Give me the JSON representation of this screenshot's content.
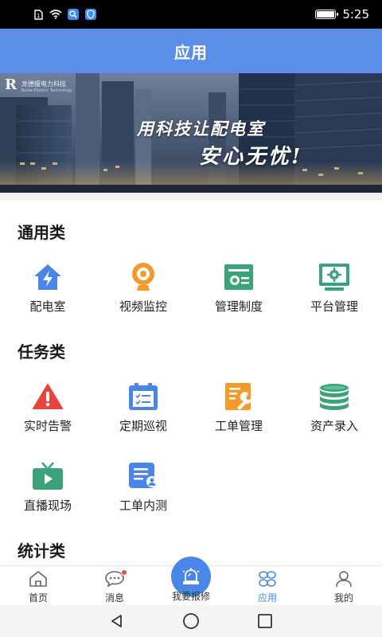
{
  "status_bar": {
    "time": "5:25",
    "icons": [
      "sim-card-icon",
      "wifi-icon",
      "search-app-icon",
      "shield-app-icon",
      "battery-icon"
    ]
  },
  "header": {
    "title": "应用"
  },
  "banner": {
    "company_mark": "R",
    "company_name": "龙德檀电力科技",
    "company_name_en": "Ruide Electric Technology",
    "slogan_line1": "用科技让配电室",
    "slogan_line2": "安心无忧!"
  },
  "sections": {
    "general": {
      "title": "通用类",
      "items": [
        {
          "label": "配电室",
          "icon": "house-lightning-icon"
        },
        {
          "label": "视频监控",
          "icon": "webcam-icon"
        },
        {
          "label": "管理制度",
          "icon": "policy-document-icon"
        },
        {
          "label": "平台管理",
          "icon": "monitor-gear-icon"
        }
      ]
    },
    "tasks": {
      "title": "任务类",
      "items": [
        {
          "label": "实时告警",
          "icon": "warning-triangle-icon"
        },
        {
          "label": "定期巡视",
          "icon": "inspection-clipboard-icon"
        },
        {
          "label": "工单管理",
          "icon": "work-order-wrench-icon"
        },
        {
          "label": "资产录入",
          "icon": "database-stack-icon"
        },
        {
          "label": "直播现场",
          "icon": "tv-play-icon"
        },
        {
          "label": "工单内测",
          "icon": "document-user-icon"
        }
      ]
    },
    "stats": {
      "title": "统计类"
    }
  },
  "bottom_nav": {
    "items": [
      {
        "label": "首页",
        "icon": "home-icon"
      },
      {
        "label": "消息",
        "icon": "chat-bubble-icon"
      },
      {
        "label": "我要报修",
        "icon": "siren-icon"
      },
      {
        "label": "应用",
        "icon": "apps-grid-icon",
        "active": true
      },
      {
        "label": "我的",
        "icon": "user-icon"
      }
    ]
  },
  "colors": {
    "header_bg": "#5b8ee6",
    "accent_blue": "#4a86e8",
    "icon_orange": "#f39a2a",
    "icon_green": "#3ba37a",
    "icon_red": "#e8453c",
    "badge_red": "#f04a4a"
  }
}
